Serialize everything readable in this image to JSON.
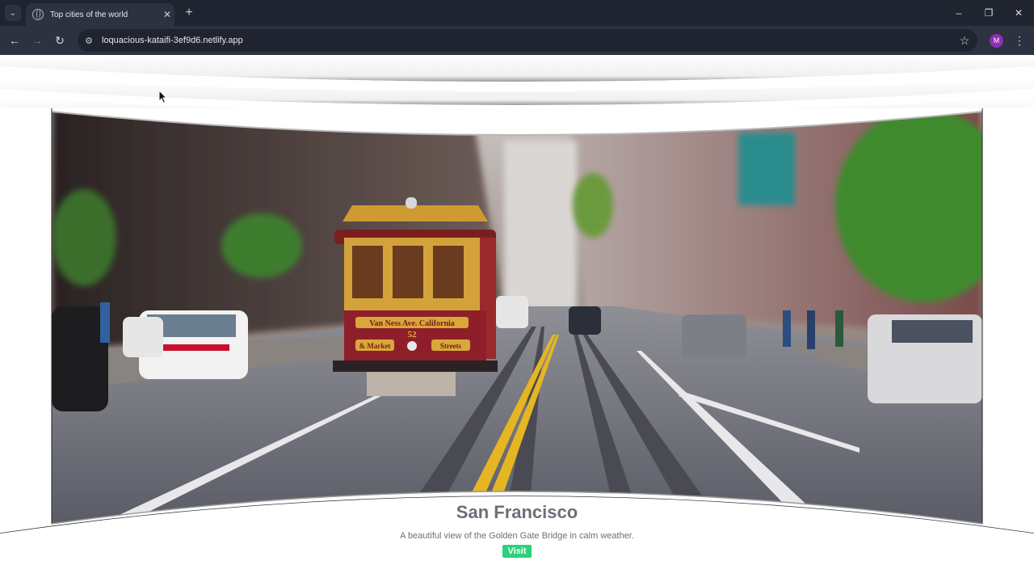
{
  "browser": {
    "tab_title": "Top cities of the world",
    "url": "loquacious-kataifi-3ef9d6.netlify.app",
    "profile_initial": "M",
    "icons": {
      "tab_menu": "chevron-down-icon",
      "tab_favicon": "globe-icon",
      "tab_close": "close-icon",
      "new_tab": "plus-icon",
      "back": "back-arrow-icon",
      "forward": "forward-arrow-icon",
      "reload": "reload-icon",
      "site_info": "tune-icon",
      "bookmark": "star-icon",
      "menu": "kebab-icon",
      "minimize": "minimize-icon",
      "maximize": "restore-icon",
      "close": "window-close-icon"
    }
  },
  "slide": {
    "title": "San Francisco",
    "description": "A beautiful view of the Golden Gate Bridge in calm weather.",
    "button_label": "Visit",
    "image_alt": "cable-car-street-photo",
    "tram_sign_top": "Van Ness Ave. California",
    "tram_number": "52",
    "tram_sign_left": "& Market",
    "tram_sign_right": "Streets"
  },
  "colors": {
    "chrome_dark": "#1f2430",
    "chrome_mid": "#2c3240",
    "accent_green": "#2bd27b",
    "text_gray": "#6b7078",
    "avatar_purple": "#8d2fb5"
  }
}
